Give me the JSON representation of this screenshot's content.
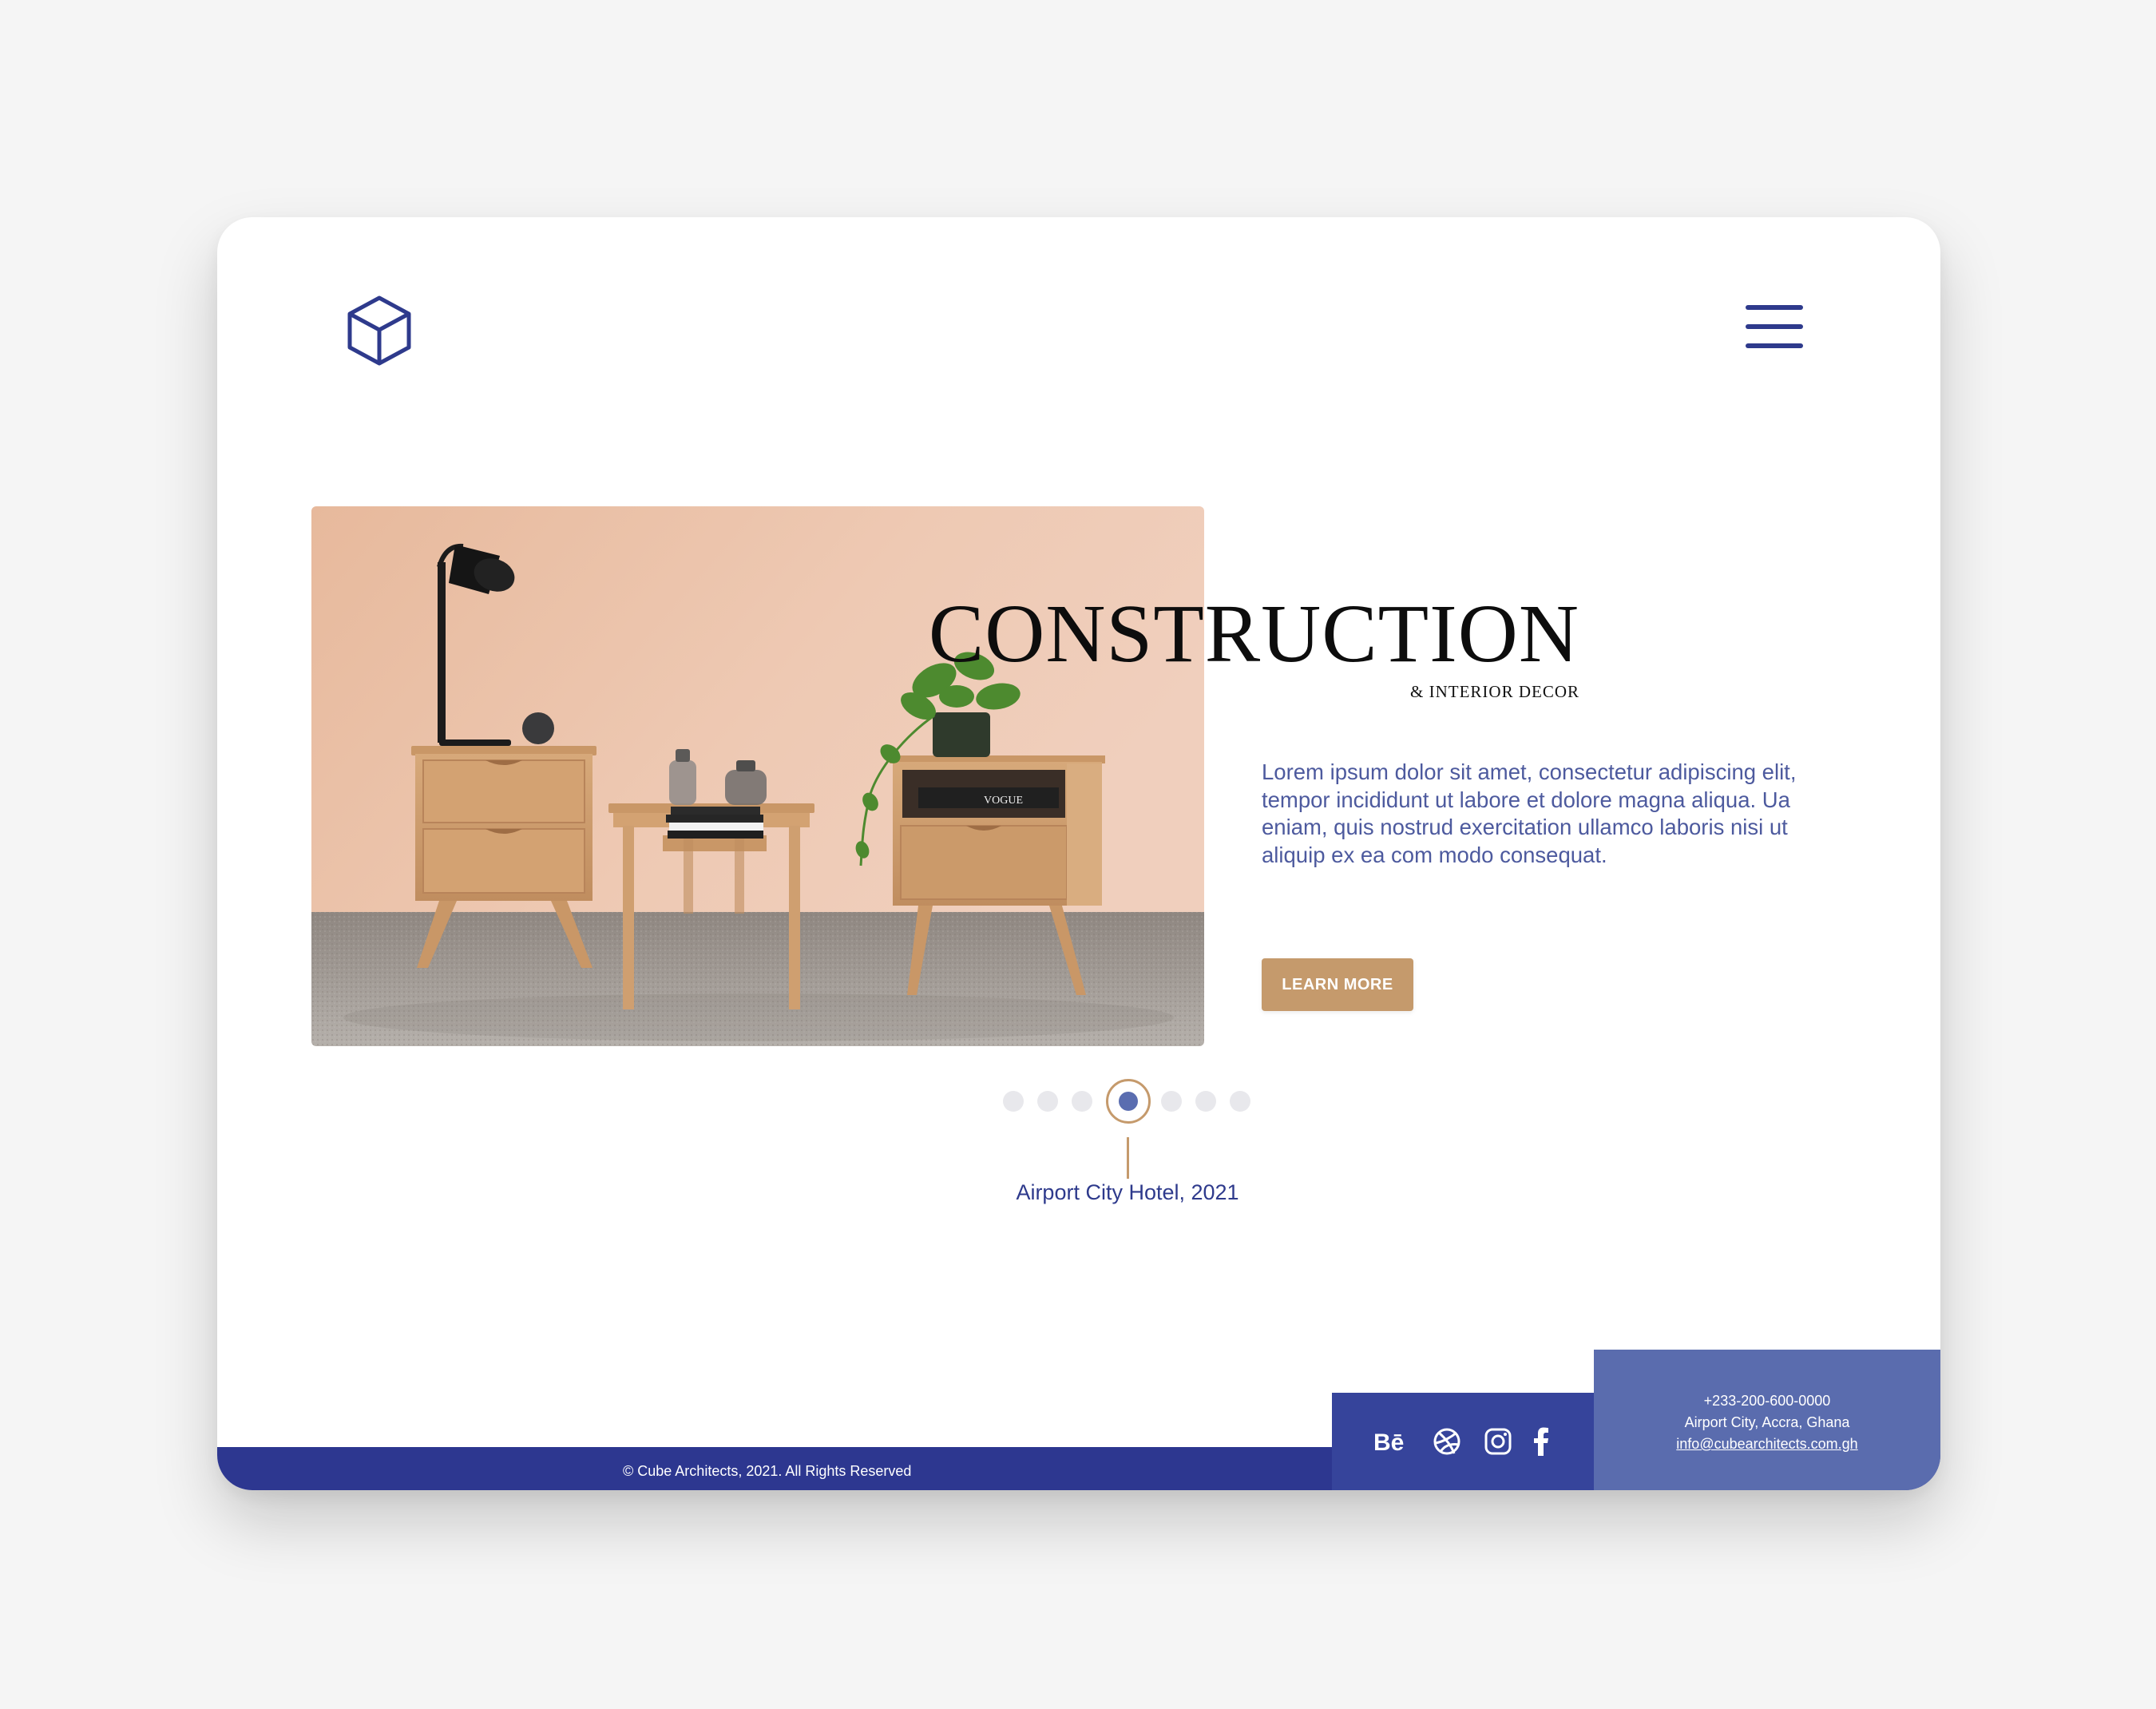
{
  "brand": {
    "logo_icon": "cube-outline-icon",
    "accent": "#2e3a8c"
  },
  "header": {
    "menu_icon": "hamburger-menu-icon"
  },
  "hero": {
    "title": "CONSTRUCTION",
    "subtitle": "& INTERIOR DECOR",
    "body": "Lorem ipsum dolor sit amet, consectetur adipiscing elit, tempor incididunt ut labore et dolore magna aliqua. Ua eniam, quis nostrud exercitation ullamco laboris nisi ut aliquip ex ea com modo consequat.",
    "cta_label": "LEARN MORE",
    "cta_color": "#c59a6c",
    "image_subject": "nightstands-with-lamp-and-plant",
    "book_label": "VOGUE"
  },
  "slider": {
    "count": 7,
    "active_index": 3,
    "caption": "Airport City Hotel, 2021"
  },
  "footer": {
    "copyright": "© Cube Architects, 2021. All Rights Reserved",
    "social": [
      "behance-icon",
      "dribbble-icon",
      "instagram-icon",
      "facebook-icon"
    ],
    "phone": "+233-200-600-0000",
    "address": "Airport City, Accra, Ghana",
    "email": "info@cubearchitects.com.gh",
    "bar_color": "#2d3790",
    "social_bg": "#36449b",
    "contact_bg": "#5a6cae"
  }
}
